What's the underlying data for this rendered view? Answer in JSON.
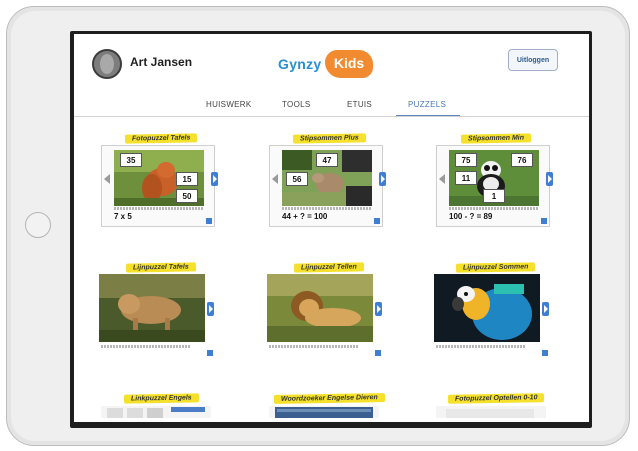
{
  "user": {
    "name": "Art Jansen"
  },
  "logo": {
    "part1": "Gynzy",
    "part2": "Kids"
  },
  "header": {
    "logout_label": "Uitloggen"
  },
  "tabs": [
    {
      "label": "HUISWERK"
    },
    {
      "label": "TOOLS"
    },
    {
      "label": "ETUIS"
    },
    {
      "label": "PUZZELS",
      "active": true
    }
  ],
  "puzzles": {
    "row1": [
      {
        "title": "Fotopuzzel Tafels",
        "numbers": [
          "35",
          "15",
          "50"
        ],
        "equation": "7 x 5"
      },
      {
        "title": "Stipsommen Plus",
        "numbers": [
          "47",
          "56"
        ],
        "equation": "44 + ? = 100"
      },
      {
        "title": "Stipsommen Min",
        "numbers": [
          "75",
          "76",
          "11",
          "1"
        ],
        "equation": "100 - ? = 89"
      }
    ],
    "row2": [
      {
        "title": "Lijnpuzzel Tafels",
        "image": "lynx"
      },
      {
        "title": "Lijnpuzzel Tellen",
        "image": "lion"
      },
      {
        "title": "Lijnpuzzel Sommen",
        "image": "parrot"
      }
    ],
    "row3": [
      {
        "title": "Linkpuzzel Engels"
      },
      {
        "title": "Woordzoeker Engelse Dieren"
      },
      {
        "title": "Fotopuzzel Optellen 0-10"
      }
    ]
  },
  "colors": {
    "accent": "#5a86c4",
    "title_highlight": "#f5e12c",
    "logo_blue": "#2a8fcf",
    "logo_orange": "#f28b30"
  }
}
